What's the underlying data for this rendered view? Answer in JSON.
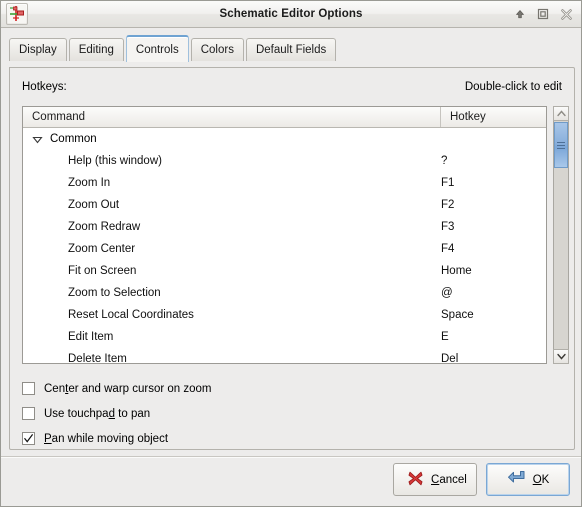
{
  "window": {
    "title": "Schematic Editor Options",
    "icon": "schematic-editor-icon",
    "controls": {
      "shade_label": "Shade",
      "maximize_label": "Maximize",
      "close_label": "Close"
    }
  },
  "tabs": [
    {
      "label": "Display",
      "active": false
    },
    {
      "label": "Editing",
      "active": false
    },
    {
      "label": "Controls",
      "active": true
    },
    {
      "label": "Colors",
      "active": false
    },
    {
      "label": "Default Fields",
      "active": false
    }
  ],
  "panel": {
    "hotkeys_label": "Hotkeys:",
    "hint": "Double-click to edit",
    "columns": {
      "command": "Command",
      "hotkey": "Hotkey"
    },
    "group": {
      "label": "Common",
      "expanded": true
    },
    "rows": [
      {
        "command": "Help (this window)",
        "hotkey": "?"
      },
      {
        "command": "Zoom In",
        "hotkey": "F1"
      },
      {
        "command": "Zoom Out",
        "hotkey": "F2"
      },
      {
        "command": "Zoom Redraw",
        "hotkey": "F3"
      },
      {
        "command": "Zoom Center",
        "hotkey": "F4"
      },
      {
        "command": "Fit on Screen",
        "hotkey": "Home"
      },
      {
        "command": "Zoom to Selection",
        "hotkey": "@"
      },
      {
        "command": "Reset Local Coordinates",
        "hotkey": "Space"
      },
      {
        "command": "Edit Item",
        "hotkey": "E"
      },
      {
        "command": "Delete Item",
        "hotkey": "Del"
      }
    ]
  },
  "options": [
    {
      "label_pre": "Cen",
      "mnemonic": "t",
      "label_post": "er and warp cursor on zoom",
      "checked": false
    },
    {
      "label_pre": "Use touchpa",
      "mnemonic": "d",
      "label_post": " to pan",
      "checked": false
    },
    {
      "label_pre": "",
      "mnemonic": "P",
      "label_post": "an while moving object",
      "checked": true
    }
  ],
  "footer": {
    "cancel": {
      "pre": "",
      "mnemonic": "C",
      "post": "ancel",
      "icon": "red-x-icon"
    },
    "ok": {
      "pre": "",
      "mnemonic": "O",
      "post": "K",
      "icon": "enter-arrow-icon"
    }
  },
  "colors": {
    "accent": "#6fa3d2",
    "scrollbar_thumb": "#8ab0dc",
    "cancel_icon": "#cc2b2b",
    "ok_icon": "#4a7fb5"
  }
}
